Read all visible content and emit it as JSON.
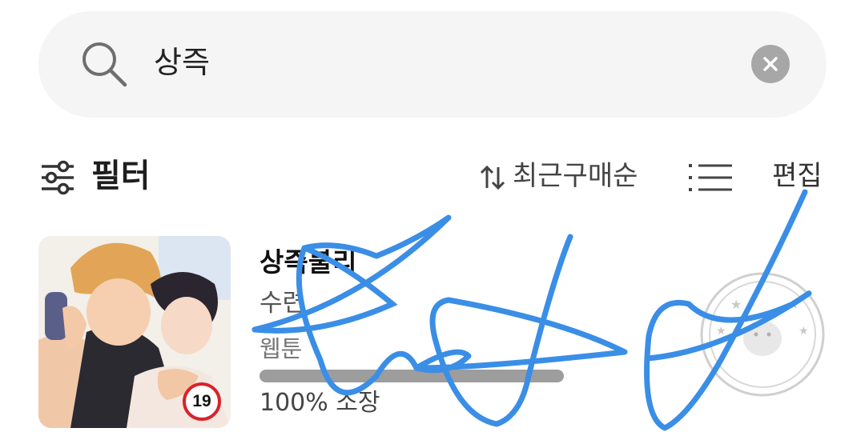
{
  "search": {
    "query": "상즉",
    "icon": "search-icon",
    "clear_icon": "close-icon"
  },
  "toolbar": {
    "filter_label": "필터",
    "sort_label": "최근구매순",
    "edit_label": "편집"
  },
  "items": [
    {
      "title": "상즉불리",
      "author": "수련",
      "category": "웹툰",
      "progress": 1.0,
      "progress_label": "100% 소장",
      "age_rating": "19"
    }
  ],
  "colors": {
    "age_badge_border": "#d8232a",
    "scribble": "#3a8ee6",
    "progress_fill": "#9d9d9d"
  }
}
